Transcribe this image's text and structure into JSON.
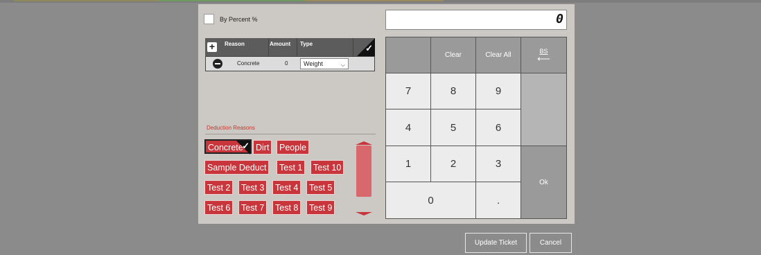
{
  "dialog": {
    "by_percent_label": "By Percent %"
  },
  "table": {
    "headers": [
      "Reason",
      "Amount",
      "Type"
    ],
    "rows": [
      {
        "reason": "Concrete",
        "amount": "0",
        "type": "Weight"
      }
    ]
  },
  "deduction": {
    "section_label": "Deduction Reasons",
    "reasons": [
      {
        "label": "Concrete",
        "selected": true
      },
      {
        "label": "Dirt",
        "selected": false
      },
      {
        "label": "People",
        "selected": false
      },
      {
        "label": "Sample Deduct",
        "selected": false
      },
      {
        "label": "Test 1",
        "selected": false
      },
      {
        "label": "Test 10",
        "selected": false
      },
      {
        "label": "Test 2",
        "selected": false
      },
      {
        "label": "Test 3",
        "selected": false
      },
      {
        "label": "Test 4",
        "selected": false
      },
      {
        "label": "Test 5",
        "selected": false
      },
      {
        "label": "Test 6",
        "selected": false
      },
      {
        "label": "Test 7",
        "selected": false
      },
      {
        "label": "Test 8",
        "selected": false
      },
      {
        "label": "Test 9",
        "selected": false
      }
    ]
  },
  "keypad": {
    "display_value": "0",
    "clear_label": "Clear",
    "clear_all_label": "Clear All",
    "bs_label": "BS",
    "ok_label": "Ok",
    "digits": {
      "d7": "7",
      "d8": "8",
      "d9": "9",
      "d4": "4",
      "d5": "5",
      "d6": "6",
      "d1": "1",
      "d2": "2",
      "d3": "3",
      "d0": "0",
      "dot": "."
    }
  },
  "footer": {
    "update_label": "Update Ticket",
    "cancel_label": "Cancel"
  },
  "colors": {
    "reason_button": "#c8363c",
    "key_dark": "#9a9a9a",
    "backdrop": "#8b8b8b"
  }
}
